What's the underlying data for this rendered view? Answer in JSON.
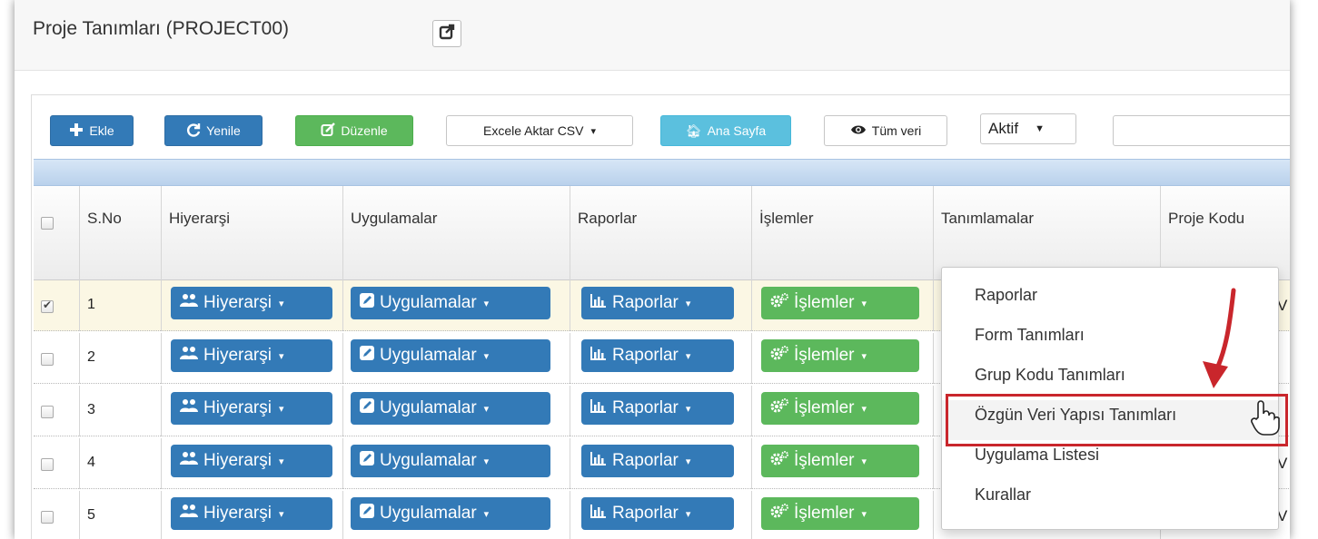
{
  "window": {
    "title": "Proje Tanımları (PROJECT00)"
  },
  "toolbar": {
    "add_label": "Ekle",
    "refresh_label": "Yenile",
    "edit_label": "Düzenle",
    "export_label": "Excele Aktar CSV",
    "home_label": "Ana Sayfa",
    "all_data_label": "Tüm veri",
    "status_select": "Aktif",
    "search_value": ""
  },
  "table": {
    "columns": [
      "S.No",
      "Hiyerarşi",
      "Uygulamalar",
      "Raporlar",
      "İşlemler",
      "Tanımlamalar",
      "Proje Kodu"
    ],
    "button_labels": {
      "hierarchy": "Hiyerarşi",
      "apps": "Uygulamalar",
      "reports": "Raporlar",
      "ops": "İşlemler"
    },
    "rows": [
      {
        "sno": "1",
        "checked": true,
        "trail": "V"
      },
      {
        "sno": "2",
        "checked": false,
        "trail": ""
      },
      {
        "sno": "3",
        "checked": false,
        "trail": ""
      },
      {
        "sno": "4",
        "checked": false,
        "trail": "V"
      },
      {
        "sno": "5",
        "checked": false,
        "trail": "V"
      }
    ]
  },
  "dropdown": {
    "items": [
      "Raporlar",
      "Form Tanımları",
      "Grup Kodu Tanımları",
      "Özgün Veri Yapısı Tanımları",
      "Uygulama Listesi",
      "Kurallar"
    ],
    "highlighted_index": 3
  },
  "colors": {
    "primary": "#337ab7",
    "success": "#5cb85c",
    "info": "#5bc0de",
    "highlight": "#c9262c"
  }
}
